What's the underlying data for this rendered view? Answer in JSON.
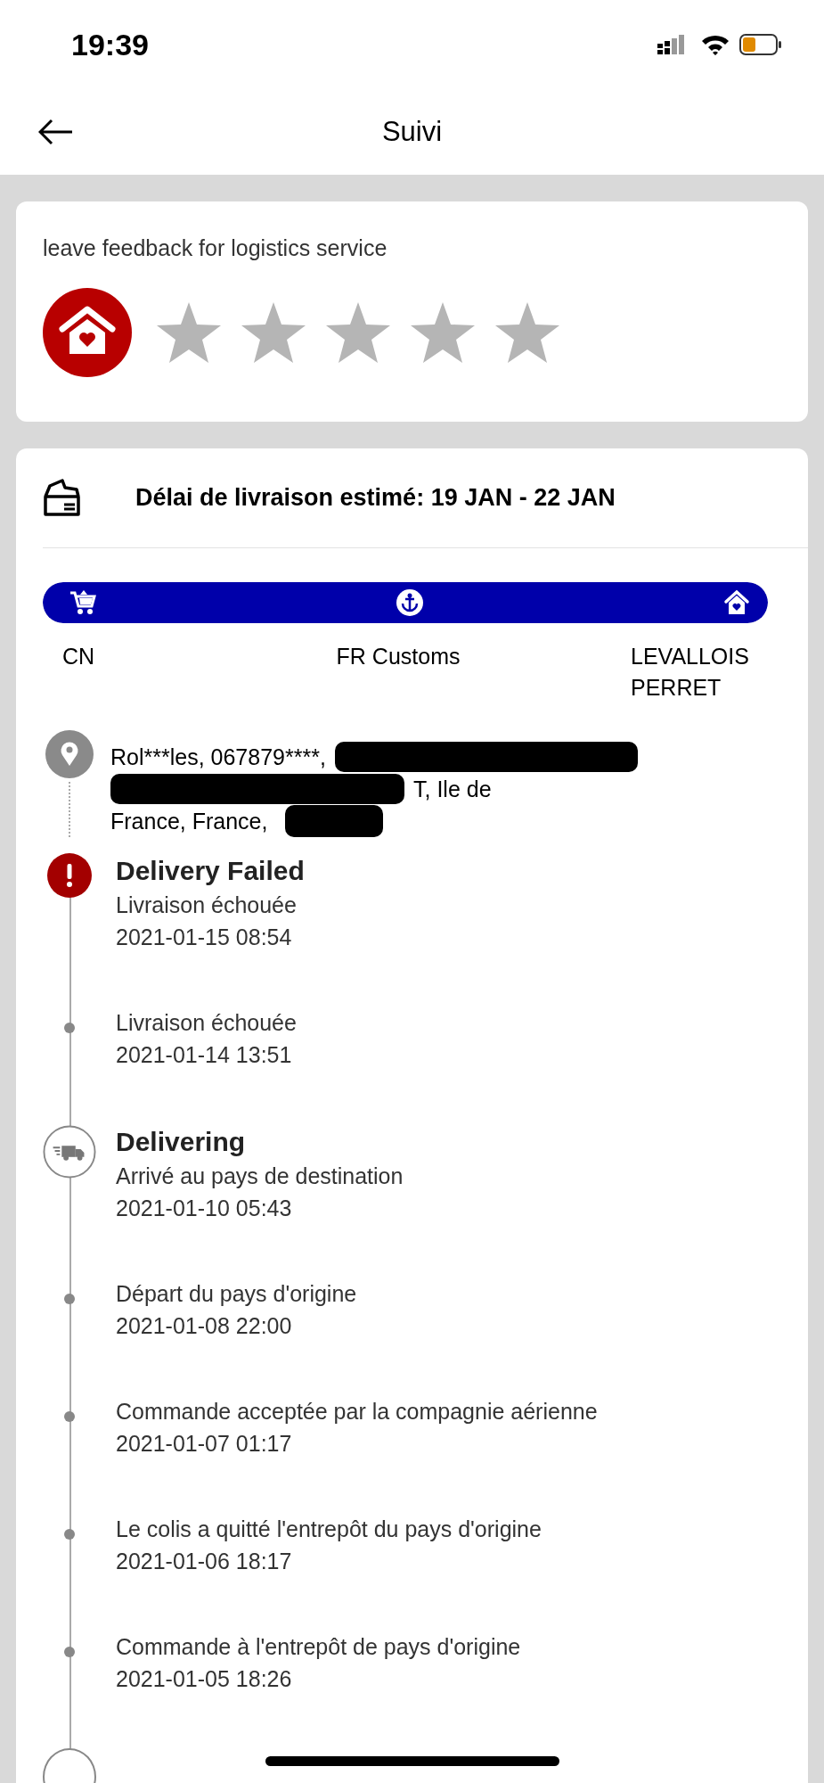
{
  "status_bar": {
    "time": "19:39"
  },
  "header": {
    "title": "Suivi"
  },
  "feedback": {
    "prompt": "leave feedback for logistics service",
    "stars": 0
  },
  "shipment": {
    "estimate": "Délai de livraison estimé: 19 JAN - 22 JAN",
    "route": {
      "level": 1,
      "stops": [
        {
          "kind": "cart",
          "label": "CN"
        },
        {
          "kind": "anchor",
          "label": "FR Customs"
        },
        {
          "kind": "home",
          "label": "LEVALLOIS PERRET"
        }
      ]
    },
    "address": [
      "Rol***les,  067879****,",
      "T,  Ile de",
      "France,  France,"
    ],
    "events": [
      {
        "kind": "failed",
        "title": "Delivery Failed",
        "text": "Livraison échouée",
        "time": "2021-01-15 08:54"
      },
      {
        "kind": "plain",
        "text": "Livraison échouée",
        "time": "2021-01-14 13:51"
      },
      {
        "kind": "delivering",
        "title": "Delivering",
        "text": "Arrivé au pays de destination",
        "time": "2021-01-10 05:43"
      },
      {
        "kind": "plain",
        "text": "Départ du pays d'origine",
        "time": "2021-01-08 22:00"
      },
      {
        "kind": "plain",
        "text": "Commande acceptée par la compagnie aérienne",
        "time": "2021-01-07 01:17"
      },
      {
        "kind": "plain",
        "text": "Le colis a quitté l'entrepôt du pays d'origine",
        "time": "2021-01-06 18:17"
      },
      {
        "kind": "plain",
        "text": "Commande à l'entrepôt de pays d'origine",
        "time": "2021-01-05 18:26"
      }
    ]
  }
}
